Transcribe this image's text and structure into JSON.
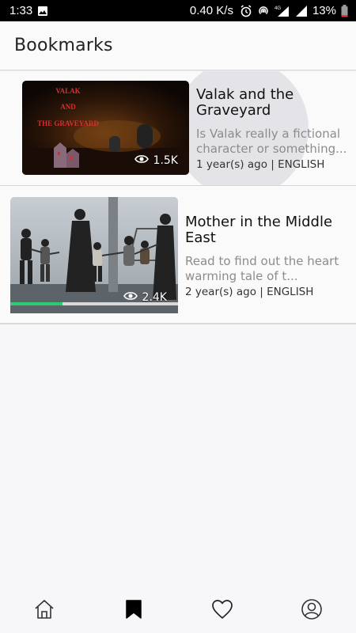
{
  "status_bar": {
    "time": "1:33",
    "net_speed": "0.40 K/s",
    "battery": "13%",
    "network_type": "4G"
  },
  "header": {
    "title": "Bookmarks"
  },
  "bookmarks": [
    {
      "title": "Valak and the Graveyard",
      "thumb_text": "VALAK AND THE GRAVEYARD",
      "description": "Is Valak really a fictional character or something...",
      "meta": "1 year(s) ago | ENGLISH",
      "views": "1.5K"
    },
    {
      "title": "Mother in the Middle East",
      "description": "Read to find out the heart warming tale of t...",
      "meta": "2 year(s) ago | ENGLISH",
      "views": "2.4K",
      "progress": 0.31
    }
  ],
  "nav": {
    "items": [
      "home-icon",
      "bookmark-icon",
      "heart-icon",
      "profile-icon"
    ],
    "active": "bookmark-icon"
  },
  "colors": {
    "progress": "#2ecc71",
    "accent": "#000000"
  }
}
